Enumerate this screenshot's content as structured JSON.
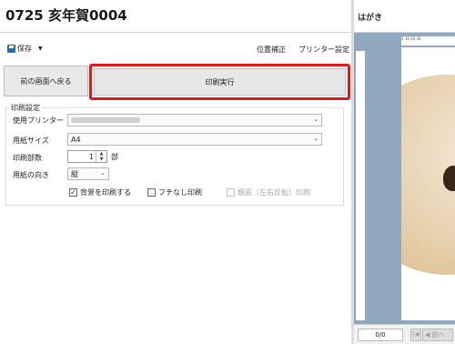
{
  "app": {
    "title": "0725 亥年賀0004"
  },
  "toolbar": {
    "save_label": "保存",
    "position_correction": "位置補正",
    "printer_settings": "プリンター設定"
  },
  "buttons": {
    "back": "前の画面へ戻る",
    "execute": "印刷実行"
  },
  "print_settings": {
    "group_label": "印刷設定",
    "printer_label": "使用プリンター",
    "printer_value": "",
    "paper_size_label": "用紙サイズ",
    "paper_size_value": "A4",
    "copies_label": "印刷部数",
    "copies_value": "1",
    "copies_unit": "部",
    "orientation_label": "用紙の向き",
    "orientation_value": "縦",
    "print_background": {
      "label": "背景を印刷する",
      "checked": true
    },
    "borderless": {
      "label": "フチなし印刷",
      "checked": false
    },
    "mirror": {
      "label": "鏡面（左右反転）印刷",
      "checked": false,
      "disabled": true
    }
  },
  "preview": {
    "title": "はがき",
    "ruler_top": "1  10  20  30",
    "page_indicator": "0/0",
    "prev_label": "前へ"
  },
  "colors": {
    "highlight": "#e01919",
    "canvas": "#8fa7bf",
    "accent": "#2b6bbf"
  },
  "icons": [
    "save-icon",
    "chevron-down-icon",
    "spin-up-icon",
    "spin-down-icon",
    "first-page-icon",
    "prev-page-icon"
  ]
}
